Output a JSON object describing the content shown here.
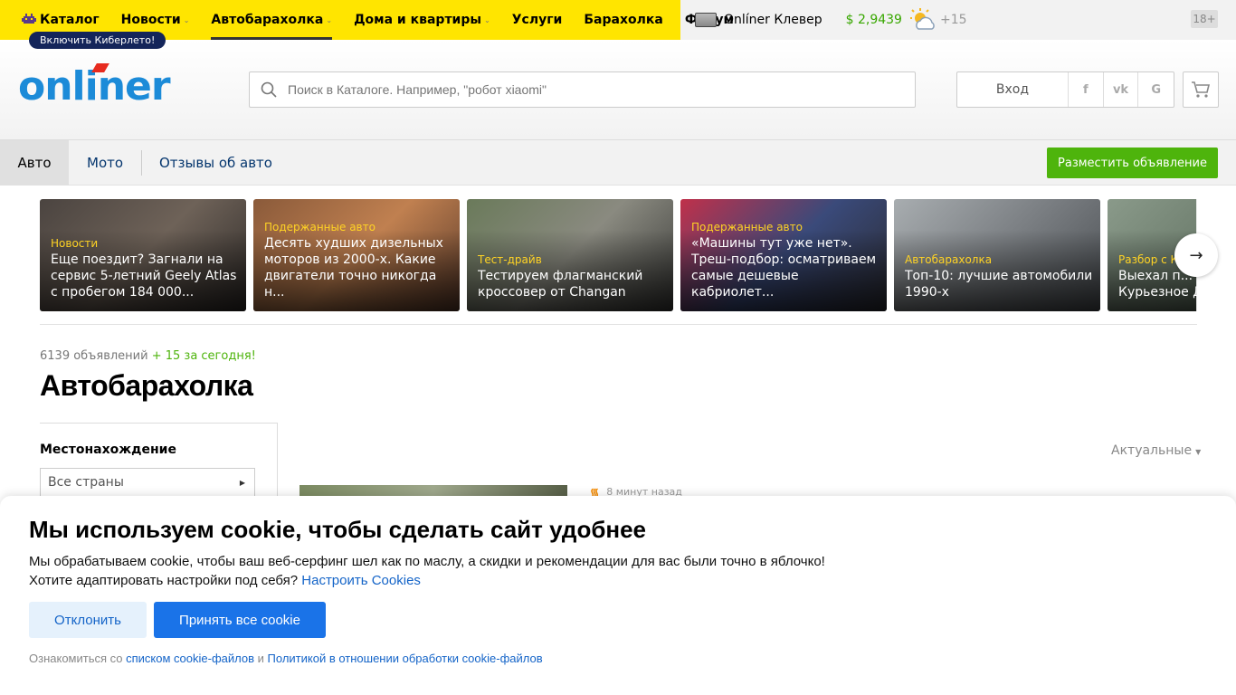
{
  "topnav": {
    "items": [
      {
        "label": "Каталог",
        "active": false,
        "chevron": false
      },
      {
        "label": "Новости",
        "active": false,
        "chevron": true
      },
      {
        "label": "Автобарахолка",
        "active": true,
        "chevron": true
      },
      {
        "label": "Дома и квартиры",
        "active": false,
        "chevron": true
      },
      {
        "label": "Услуги",
        "active": false,
        "chevron": false
      },
      {
        "label": "Барахолка",
        "active": false,
        "chevron": false
      },
      {
        "label": "Форум",
        "active": false,
        "chevron": false
      }
    ],
    "cyber_badge": "Включить Киберлето!",
    "clever_label": "Onlíner Клевер",
    "rate": "$ 2,9439",
    "temperature": "+15",
    "age": "18+",
    "colors": {
      "bar": "#ffe500",
      "rate": "#38a700"
    }
  },
  "header": {
    "logo": "onliner",
    "search_placeholder": "Поиск в Каталоге. Например, \"робот xiaomi\"",
    "login_label": "Вход",
    "social": [
      "f",
      "vk",
      "G"
    ],
    "colors": {
      "logo": "#1c8bd8",
      "logo_accent": "#e72b1f"
    }
  },
  "subnav": {
    "tabs": [
      "Авто",
      "Мото",
      "Отзывы об авто"
    ],
    "place_ad": "Разместить объявление",
    "place_ad_color": "#4eb40c"
  },
  "news": [
    {
      "category": "Новости",
      "title": "Еще поездит? Загнали на сервис 5-летний Geely Atlas с пробегом 184 000...",
      "colors": [
        "#4b4440",
        "#6e6258",
        "#2e2a28"
      ]
    },
    {
      "category": "Подержанные авто",
      "title": "Десять худших дизельных моторов из 2000-х. Какие двигатели точно никогда н...",
      "colors": [
        "#8a5a3a",
        "#c08050",
        "#5a3a2a"
      ]
    },
    {
      "category": "Тест-драйв",
      "title": "Тестируем флагманский кроссовер от Changan",
      "colors": [
        "#6a7a5a",
        "#8a8a80",
        "#3a3a38"
      ]
    },
    {
      "category": "Подержанные авто",
      "title": "«Машины тут уже нет». Треш-подбор: осматриваем самые дешевые кабриолет...",
      "colors": [
        "#c0304a",
        "#3a4a7a",
        "#2a2a30"
      ]
    },
    {
      "category": "Автобарахолка",
      "title": "Топ-10: лучшие автомобили 1990-х",
      "colors": [
        "#a8adb0",
        "#7a7e82",
        "#4a4e52"
      ]
    },
    {
      "category": "Разбор с Ки",
      "title": "Выехал п... ударил по ... Курьезное Д...",
      "colors": [
        "#8a9a8a",
        "#6a7a6a",
        "#3a4a3a"
      ]
    }
  ],
  "listing": {
    "count": "6139 объявлений",
    "today": "+ 15 за сегодня!",
    "title": "Автобарахолка",
    "location_label": "Местонахождение",
    "location_value": "Все страны",
    "sort_label": "Актуальные",
    "first_time": "8 минут назад"
  },
  "cookie": {
    "title": "Мы используем cookie, чтобы сделать сайт удобнее",
    "line1": "Мы обрабатываем cookie, чтобы ваш веб-серфинг шел как по маслу, а скидки и рекомендации для вас были точно в яблочко!",
    "line2": "Хотите адаптировать настройки под себя?",
    "settings_link": "Настроить Cookies",
    "decline": "Отклонить",
    "accept": "Принять все cookie",
    "foot_prefix": "Ознакомиться со",
    "foot_link1": "списком cookie-файлов",
    "foot_and": "и",
    "foot_link2": "Политикой в отношении обработки cookie-файлов",
    "colors": {
      "link": "#1464c8",
      "accept": "#1a73e8",
      "decline_bg": "#e5f1fc"
    }
  }
}
